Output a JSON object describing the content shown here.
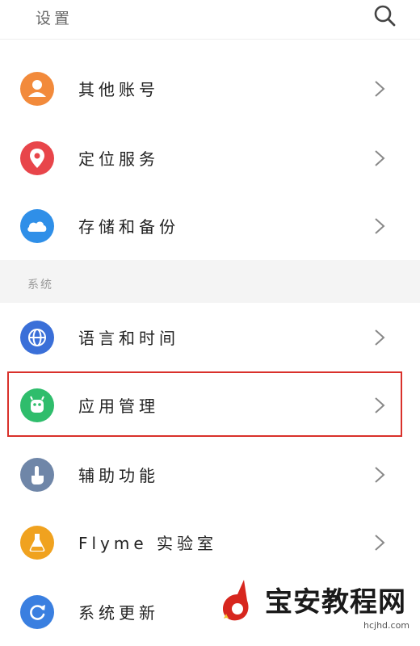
{
  "header": {
    "title": "设置"
  },
  "accounts": [
    {
      "label": "其他账号",
      "icon": "person-icon",
      "color": "#f28a3b"
    },
    {
      "label": "定位服务",
      "icon": "location-pin-icon",
      "color": "#e8454a"
    },
    {
      "label": "存储和备份",
      "icon": "cloud-icon",
      "color": "#2f8fe8"
    }
  ],
  "system": {
    "section_title": "系统",
    "items": [
      {
        "label": "语言和时间",
        "icon": "globe-icon",
        "color": "#3a6fd8"
      },
      {
        "label": "应用管理",
        "icon": "android-icon",
        "color": "#2fbd6c"
      },
      {
        "label": "辅助功能",
        "icon": "hand-pointer-icon",
        "color": "#6f86a8"
      },
      {
        "label": "Flyme 实验室",
        "icon": "flask-icon",
        "color": "#f0a21f"
      },
      {
        "label": "系统更新",
        "icon": "refresh-icon",
        "color": "#3a7fe0"
      }
    ]
  },
  "watermark": {
    "text": "宝安教程网",
    "url": "hcjhd.com"
  }
}
